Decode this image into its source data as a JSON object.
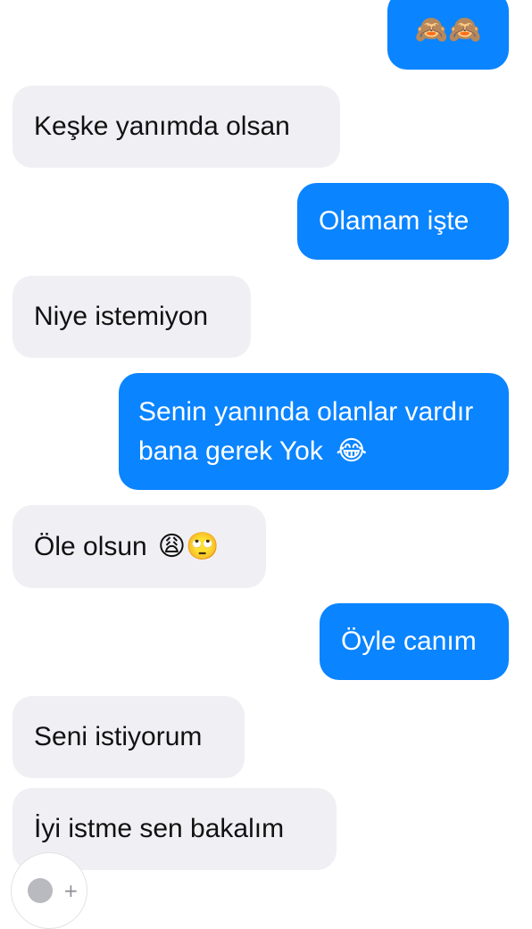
{
  "messages": [
    {
      "side": "sent",
      "text": "",
      "emoji": "🙈🙈"
    },
    {
      "side": "recv",
      "text": "Keşke yanımda olsan",
      "emoji": ""
    },
    {
      "side": "sent",
      "text": "Olamam işte",
      "emoji": ""
    },
    {
      "side": "recv",
      "text": "Niye istemiyon",
      "emoji": ""
    },
    {
      "side": "sent",
      "text": "Senin yanında olanlar vardır bana gerek Yok",
      "emoji": "😂"
    },
    {
      "side": "recv",
      "text": "Öle olsun",
      "emoji": "😩🙄"
    },
    {
      "side": "sent",
      "text": "Öyle canım",
      "emoji": ""
    },
    {
      "side": "recv",
      "text": "Seni istiyorum",
      "emoji": ""
    },
    {
      "side": "recv",
      "text": "İyi istme sen bakalım",
      "emoji": ""
    }
  ],
  "icons": {
    "reaction": "smiley-icon",
    "add": "plus-icon"
  },
  "colors": {
    "sent_bubble": "#0a84ff",
    "received_bubble": "#f0f0f4"
  }
}
